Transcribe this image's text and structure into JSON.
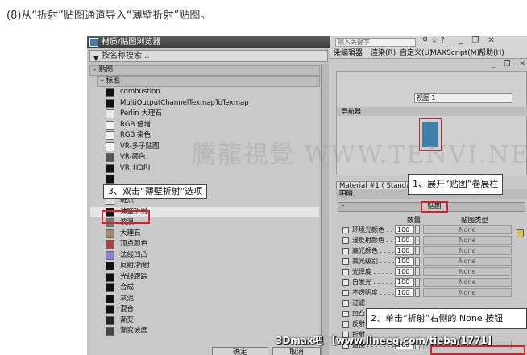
{
  "caption": "(8)从“折射”贴图通道导入“薄壁折射”贴图。",
  "browser": {
    "title": "材质/贴图浏览器",
    "search_placeholder": "按名称搜索...",
    "section_maps": "- 贴图",
    "section_standard": "- 标准",
    "items": [
      {
        "label": "combustion",
        "swatch": "#111111"
      },
      {
        "label": "MultiOutputChannelTexmapToTexmap",
        "swatch": "#111111"
      },
      {
        "label": "Perlin 大理石",
        "swatch": "#e8e8e8"
      },
      {
        "label": "RGB 倍增",
        "swatch": "#f2f2f2"
      },
      {
        "label": "RGB 染色",
        "swatch": "#f2f2f2"
      },
      {
        "label": "VR-多子贴图",
        "swatch": "#f2f2f2"
      },
      {
        "label": "VR-颜色",
        "swatch": "#555555"
      },
      {
        "label": "VR_HDRI",
        "swatch": "#111111"
      },
      {
        "label": "",
        "swatch": "#111111"
      },
      {
        "label": "",
        "swatch": "#111111"
      },
      {
        "label": "斑点",
        "swatch": "#dddddd"
      },
      {
        "label": "薄壁折射",
        "swatch": "#111111"
      },
      {
        "label": "波浪",
        "swatch": "#777777"
      },
      {
        "label": "大理石",
        "swatch": "#a08a6a"
      },
      {
        "label": "顶点颜色",
        "swatch": "#b04040"
      },
      {
        "label": "法线凹凸",
        "swatch": "#8a7fe0"
      },
      {
        "label": "反射/折射",
        "swatch": "#111111"
      },
      {
        "label": "光线跟踪",
        "swatch": "#111111"
      },
      {
        "label": "合成",
        "swatch": "#111111"
      },
      {
        "label": "灰泥",
        "swatch": "#111111"
      },
      {
        "label": "混合",
        "swatch": "#111111"
      },
      {
        "label": "渐变",
        "swatch": "#222222"
      },
      {
        "label": "渐变坡度",
        "swatch": "#444444"
      }
    ],
    "ok_label": "确定",
    "cancel_label": "取消"
  },
  "max": {
    "search_placeholder": "输入关键字",
    "menus": [
      "染编辑器",
      "渲染(R)",
      "自定义(U)",
      "MAXScript(M)",
      "帮助(H)"
    ],
    "view_label": "视图 1",
    "navigator": "导航器",
    "material_tab": "Material #1 ( Standa",
    "shader_label": "明暗",
    "rollout_title": "贴图",
    "col_amount": "数量",
    "col_maptype": "贴图类型",
    "rows": [
      {
        "label": "环境光颜色 . . . .",
        "amount": "100",
        "map": "None"
      },
      {
        "label": "漫反射颜色 . . . .",
        "amount": "100",
        "map": "None"
      },
      {
        "label": "高光颜色 . . . . .",
        "amount": "100",
        "map": "None"
      },
      {
        "label": "高光级别 . . . . .",
        "amount": "100",
        "map": "None"
      },
      {
        "label": "光泽度 . . . . . .",
        "amount": "100",
        "map": "None"
      },
      {
        "label": "自发光 . . . . . .",
        "amount": "100",
        "map": "None"
      },
      {
        "label": "不透明度 . . . . .",
        "amount": "100",
        "map": "None"
      },
      {
        "label": "过滤",
        "amount": "",
        "map": ""
      },
      {
        "label": "凹凸",
        "amount": "",
        "map": ""
      },
      {
        "label": "反射",
        "amount": "",
        "map": ""
      },
      {
        "label": "折射",
        "amount": "",
        "map": ""
      },
      {
        "label": "置换 . . . . . . .",
        "amount": "100",
        "map": "None"
      }
    ]
  },
  "callouts": {
    "c1": "1、展开“贴图”卷展栏",
    "c2": "2、单击“折射”右侧的 None 按钮",
    "c3": "3、双击“薄壁折射”选项"
  },
  "watermark": "騰龍視覺 WWW.TENVI.NET",
  "footer_mark": "3Dmax吧 【www.lineeg.com/tieba/1771】",
  "colors": {
    "highlight": "#d8202a",
    "swatch_blue": "#3f7fa8"
  }
}
